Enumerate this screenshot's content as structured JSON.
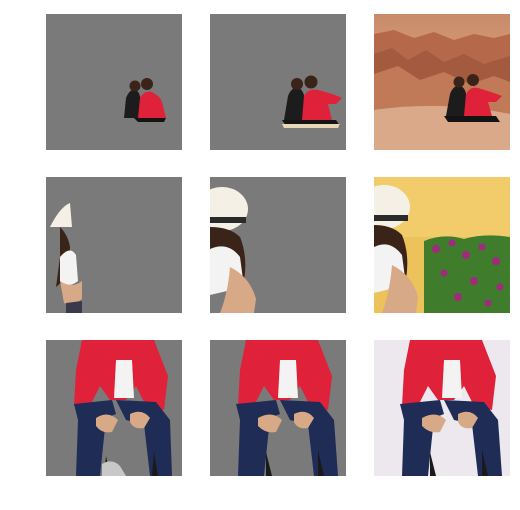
{
  "colors": {
    "mask_gray": "#7a7a7a",
    "red_jacket": "#e0213a",
    "dark_jacket": "#1c1c1c",
    "hair": "#3a2318",
    "desert_sky_top": "#c98b6a",
    "desert_sky_bottom": "#e8b88a",
    "desert_hills": "#b5694a",
    "desert_ground": "#d9a98a",
    "hat": "#f4f0e6",
    "hat_band": "#2a2a2a",
    "skin": "#d8a987",
    "white_top": "#f3f3f3",
    "yellow_wall": "#eec25a",
    "flowers": "#a12a7c",
    "leaves": "#3f7d2c",
    "jeans": "#1f2c55",
    "chair": "#1a1a1a",
    "light_bg": "#ece8ee"
  },
  "rows": [
    {
      "name": "couple-desert",
      "tiles": [
        {
          "variant": "segmented-mask",
          "icon": "couple-on-gray"
        },
        {
          "variant": "segmented-mask-refined",
          "icon": "couple-on-gray"
        },
        {
          "variant": "original-photo",
          "icon": "couple-desert-photo"
        }
      ]
    },
    {
      "name": "woman-hat-flowers",
      "tiles": [
        {
          "variant": "segmented-mask",
          "icon": "hat-woman-on-gray"
        },
        {
          "variant": "segmented-mask-refined",
          "icon": "hat-woman-on-gray"
        },
        {
          "variant": "original-photo",
          "icon": "hat-woman-flowers-photo"
        }
      ]
    },
    {
      "name": "woman-red-jacket-seated",
      "tiles": [
        {
          "variant": "segmented-mask",
          "icon": "seated-woman-on-gray"
        },
        {
          "variant": "segmented-mask-refined",
          "icon": "seated-woman-on-gray"
        },
        {
          "variant": "original-photo",
          "icon": "seated-woman-photo"
        }
      ]
    }
  ]
}
